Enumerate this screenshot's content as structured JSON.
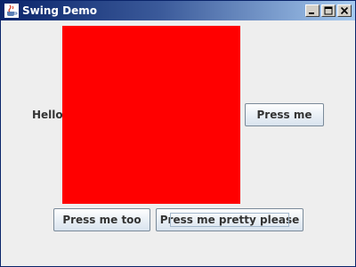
{
  "window": {
    "title": "Swing Demo",
    "controls": {
      "minimize": "minimize",
      "maximize": "maximize",
      "close": "close"
    },
    "app_icon": "java-cup-icon"
  },
  "content": {
    "label": "Hello",
    "panel_color": "#ff0000",
    "buttons": {
      "press_me": "Press me",
      "press_me_too": "Press me too",
      "press_me_pretty": "Press me pretty please"
    }
  },
  "colors": {
    "titlebar_start": "#0a246a",
    "titlebar_end": "#a6caf0",
    "background": "#eeeeee",
    "panel": "#ff0000"
  }
}
